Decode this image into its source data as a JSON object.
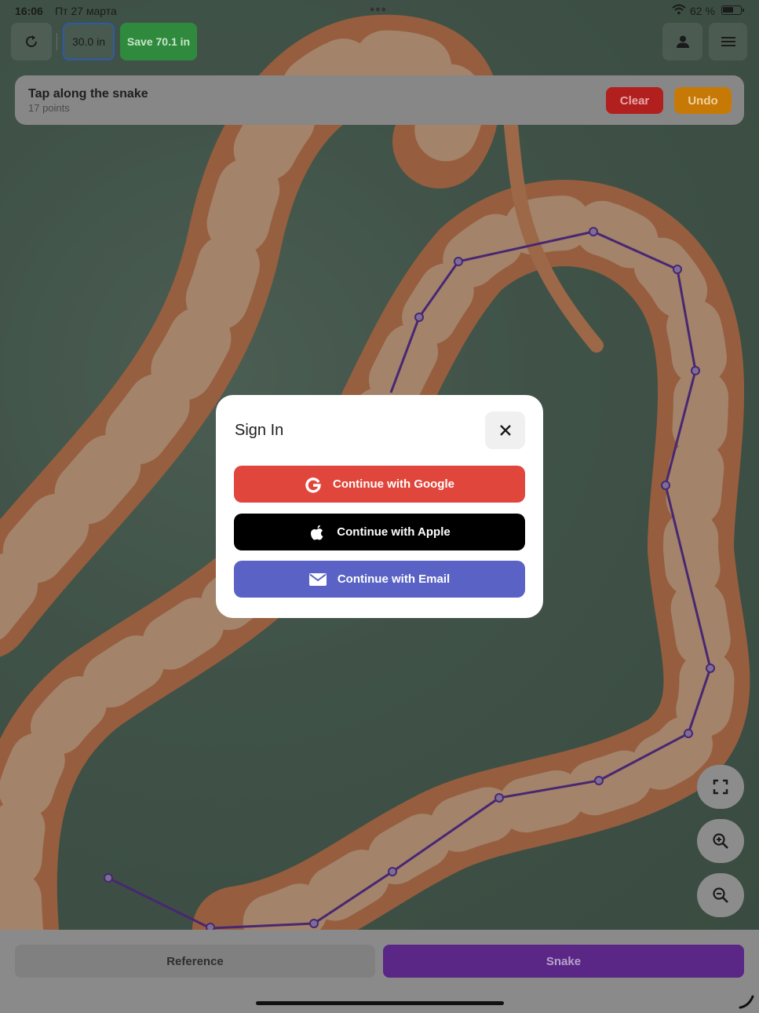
{
  "status": {
    "time": "16:06",
    "date": "Пт 27 марта",
    "dots": "•••",
    "battery_pct": "62 %",
    "battery_level": 0.62
  },
  "toolbar": {
    "length_label": "30.0 in",
    "save_label": "Save 70.1 in"
  },
  "instruction": {
    "title": "Tap along the snake",
    "points": "17 points",
    "clear_label": "Clear",
    "undo_label": "Undo"
  },
  "modal": {
    "title": "Sign In",
    "google_label": "Continue with Google",
    "apple_label": "Continue with Apple",
    "email_label": "Continue with Email"
  },
  "tabs": {
    "reference_label": "Reference",
    "snake_label": "Snake"
  },
  "colors": {
    "google": "#e0463c",
    "apple": "#000000",
    "email": "#5a63c5",
    "save": "#2f8a3e",
    "clear": "#b21f1f",
    "undo": "#c77906",
    "snake_tab": "#5a2786",
    "trace": "#6a3aa8"
  },
  "icons": [
    "refresh-icon",
    "user-icon",
    "menu-icon",
    "close-icon",
    "google-icon",
    "apple-icon",
    "email-icon",
    "fullscreen-icon",
    "zoom-in-icon",
    "zoom-out-icon"
  ]
}
